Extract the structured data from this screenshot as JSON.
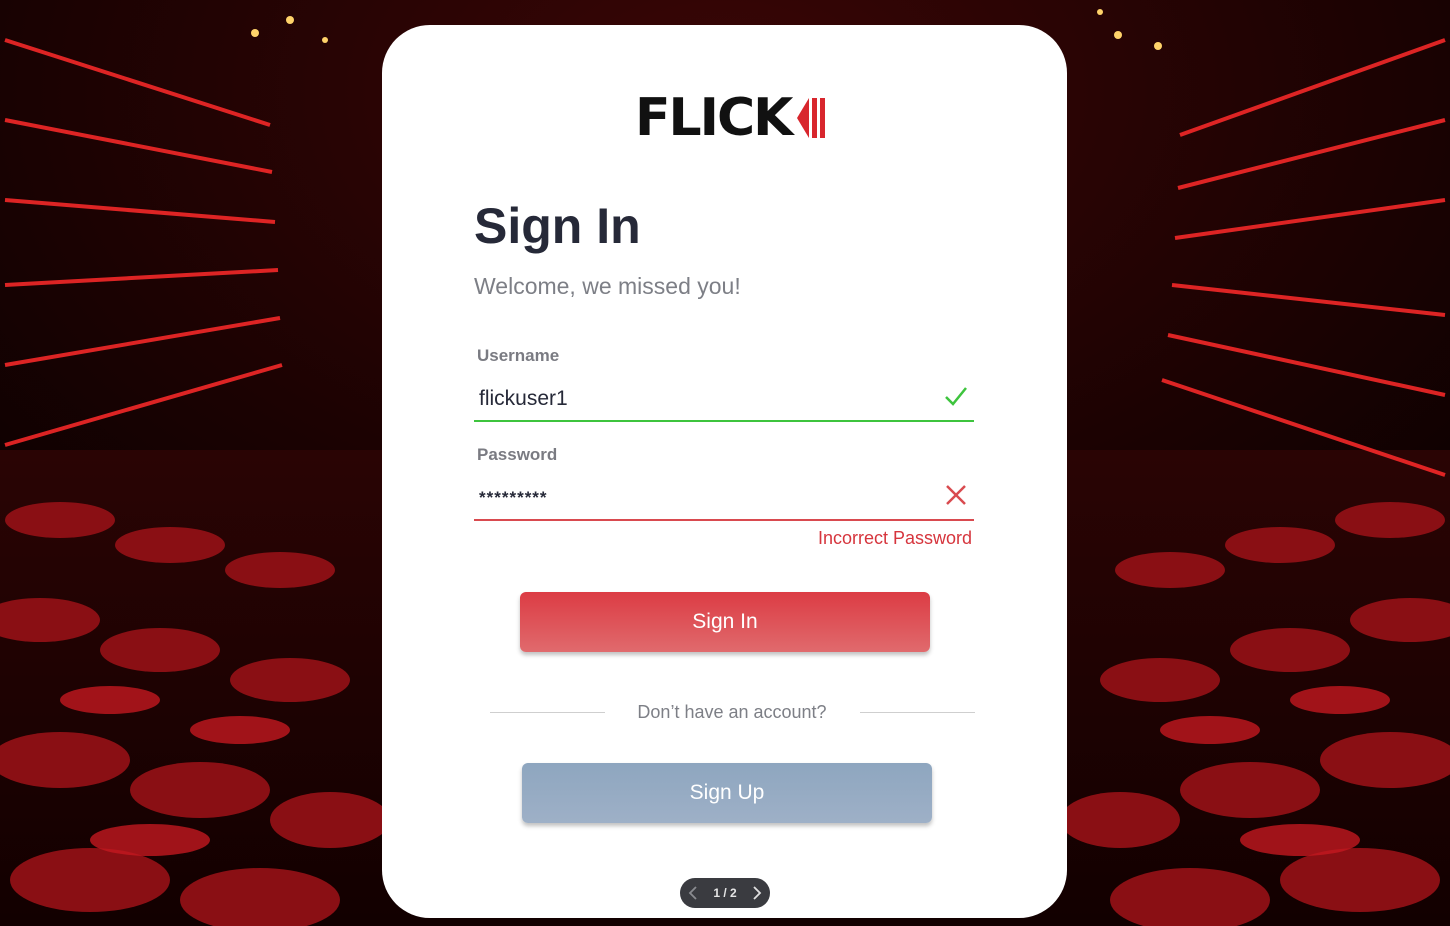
{
  "brand": {
    "logo_text": "FLICK",
    "accent_color": "#d8262d"
  },
  "signin": {
    "title": "Sign In",
    "subtitle": "Welcome, we missed you!",
    "username": {
      "label": "Username",
      "value": "flickuser1",
      "status_icon": "check-icon",
      "status_color": "#3ec43e"
    },
    "password": {
      "label": "Password",
      "value": "*********",
      "status_icon": "close-icon",
      "status_color": "#d94a4f",
      "error": "Incorrect Password"
    },
    "submit_label": "Sign In",
    "divider_text": "Don’t have an account?",
    "signup_label": "Sign Up"
  },
  "pager": {
    "text": "1 / 2",
    "prev_icon": "chevron-left-icon",
    "next_icon": "chevron-right-icon"
  }
}
